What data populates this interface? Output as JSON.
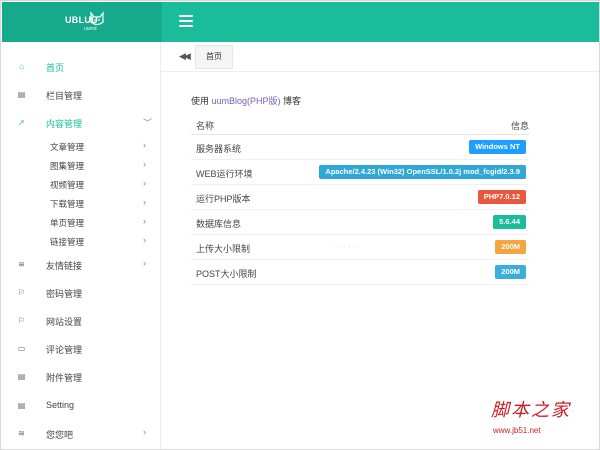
{
  "logo": {
    "text": "UBLUU",
    "sub": "uumd"
  },
  "colors": {
    "primary": "#1abc9c",
    "primary_dark": "#17a98c",
    "link": "#7b5db5"
  },
  "sidebar": {
    "items": [
      {
        "icon": "home-icon",
        "glyph": "⌂",
        "label": "首页",
        "active": true
      },
      {
        "icon": "document-icon",
        "glyph": "▤",
        "label": "栏目管理"
      },
      {
        "icon": "send-icon",
        "glyph": "➚",
        "label": "内容管理",
        "active": true,
        "expanded": true,
        "chevron": "﹀"
      }
    ],
    "subitems": [
      {
        "label": "文章管理",
        "chevron": "›"
      },
      {
        "label": "图集管理",
        "chevron": "›"
      },
      {
        "label": "视频管理",
        "chevron": "›"
      },
      {
        "label": "下载管理",
        "chevron": "›"
      },
      {
        "label": "单页管理",
        "chevron": "›"
      },
      {
        "label": "链接管理",
        "chevron": "›"
      }
    ],
    "items2": [
      {
        "icon": "layers-icon",
        "glyph": "≋",
        "label": "友情链接",
        "chevron": "›"
      },
      {
        "icon": "flag-icon",
        "glyph": "⚐",
        "label": "密码管理"
      },
      {
        "icon": "flag-icon",
        "glyph": "⚐",
        "label": "网站设置"
      },
      {
        "icon": "comment-icon",
        "glyph": "▭",
        "label": "评论管理"
      },
      {
        "icon": "document-icon",
        "glyph": "▤",
        "label": "附件管理"
      },
      {
        "icon": "document-icon",
        "glyph": "▤",
        "label": "Setting"
      },
      {
        "icon": "layers-icon",
        "glyph": "≋",
        "label": "您您吧",
        "chevron": "›"
      }
    ]
  },
  "tabbar": {
    "prev": "◀◀",
    "home_tab": "首页"
  },
  "main": {
    "intro_prefix": "使用 ",
    "intro_link": "uumBlog(PHP版)",
    "intro_suffix": " 博客",
    "table": {
      "head_key": "名称",
      "head_val": "信息",
      "rows": [
        {
          "key": "服务器系统",
          "value": "Windows NT",
          "color": "#1e9fff"
        },
        {
          "key": "WEB运行环境",
          "value": "Apache/2.4.23 (Win32) OpenSSL/1.0.2j mod_fcgid/2.3.9",
          "color": "#2fa8d8"
        },
        {
          "key": "运行PHP版本",
          "value": "PHP7.0.12",
          "color": "#e9573f"
        },
        {
          "key": "数据库信息",
          "value": "5.6.44",
          "color": "#1abc9c"
        },
        {
          "key": "上传大小限制",
          "value": "200M",
          "color": "#f5a442"
        },
        {
          "key": "POST大小限制",
          "value": "200M",
          "color": "#3bafda"
        }
      ]
    }
  },
  "watermark": {
    "cn": "脚本之家",
    "url": "www.jb51.net"
  }
}
